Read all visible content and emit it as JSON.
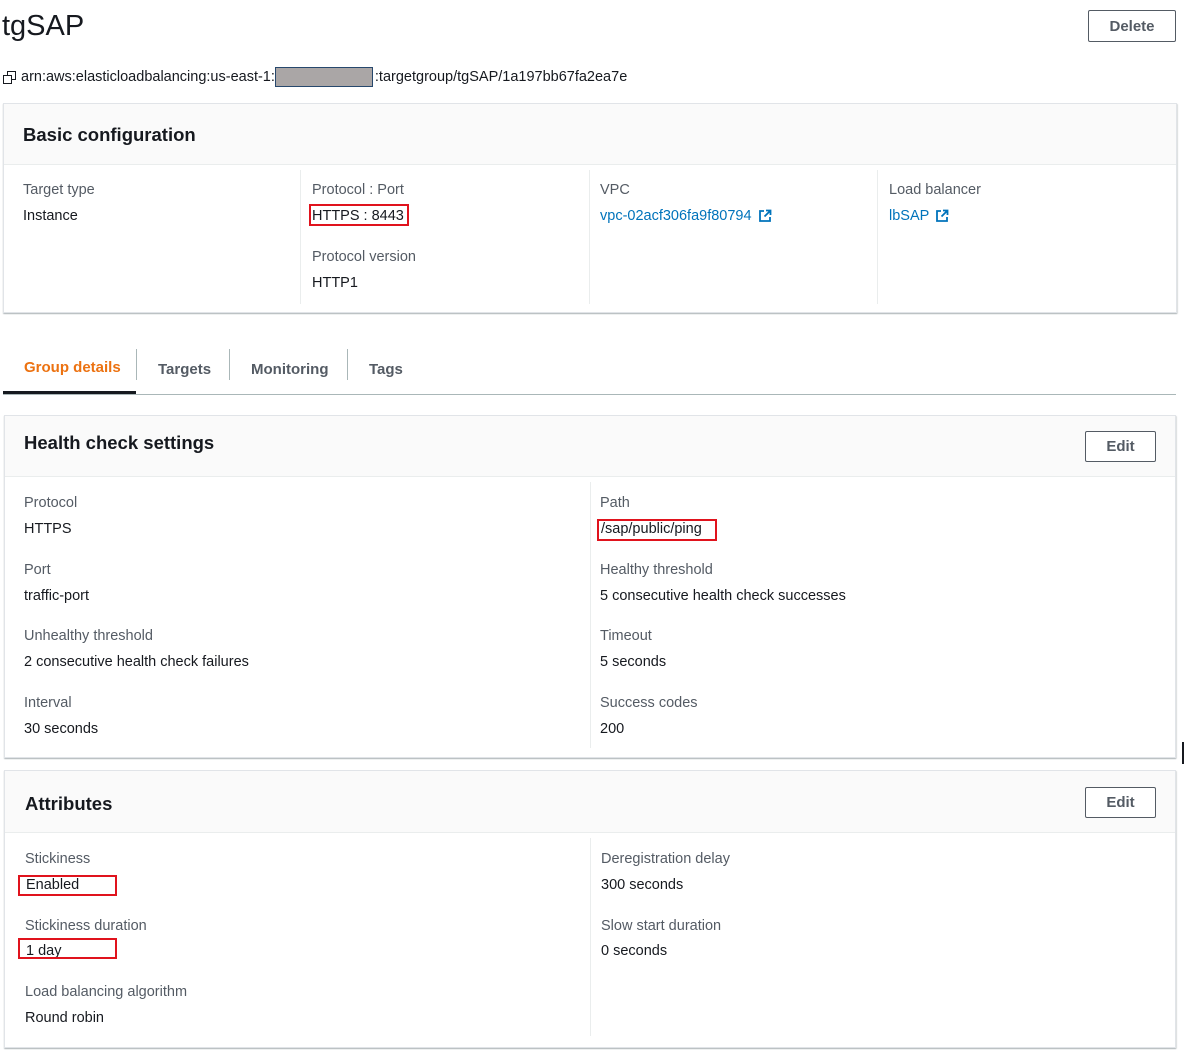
{
  "page": {
    "title": "tgSAP",
    "delete_label": "Delete",
    "arn_prefix": "arn:aws:elasticloadbalancing:us-east-1:",
    "arn_suffix": ":targetgroup/tgSAP/1a197bb67fa2ea7e"
  },
  "basic_config": {
    "title": "Basic configuration",
    "target_type_label": "Target type",
    "target_type_value": "Instance",
    "protocol_port_label": "Protocol : Port",
    "protocol_port_value": "HTTPS : 8443",
    "protocol_version_label": "Protocol version",
    "protocol_version_value": "HTTP1",
    "vpc_label": "VPC",
    "vpc_value": "vpc-02acf306fa9f80794",
    "lb_label": "Load balancer",
    "lb_value": "lbSAP"
  },
  "tabs": [
    {
      "label": "Group details",
      "active": true
    },
    {
      "label": "Targets",
      "active": false
    },
    {
      "label": "Monitoring",
      "active": false
    },
    {
      "label": "Tags",
      "active": false
    }
  ],
  "health_check": {
    "title": "Health check settings",
    "edit_label": "Edit",
    "protocol_label": "Protocol",
    "protocol_value": "HTTPS",
    "port_label": "Port",
    "port_value": "traffic-port",
    "unhealthy_label": "Unhealthy threshold",
    "unhealthy_value": "2 consecutive health check failures",
    "interval_label": "Interval",
    "interval_value": "30 seconds",
    "path_label": "Path",
    "path_value": "/sap/public/ping",
    "healthy_label": "Healthy threshold",
    "healthy_value": "5 consecutive health check successes",
    "timeout_label": "Timeout",
    "timeout_value": "5 seconds",
    "success_label": "Success codes",
    "success_value": "200"
  },
  "attributes": {
    "title": "Attributes",
    "edit_label": "Edit",
    "stickiness_label": "Stickiness",
    "stickiness_value": "Enabled",
    "stickiness_duration_label": "Stickiness duration",
    "stickiness_duration_value": "1 day",
    "algorithm_label": "Load balancing algorithm",
    "algorithm_value": "Round robin",
    "dereg_label": "Deregistration delay",
    "dereg_value": "300 seconds",
    "slow_start_label": "Slow start duration",
    "slow_start_value": "0 seconds"
  },
  "colors": {
    "link": "#0073bb",
    "active_tab": "#ec7211",
    "highlight_box": "#e0131d",
    "arn_mask": "#aaa6a6"
  }
}
